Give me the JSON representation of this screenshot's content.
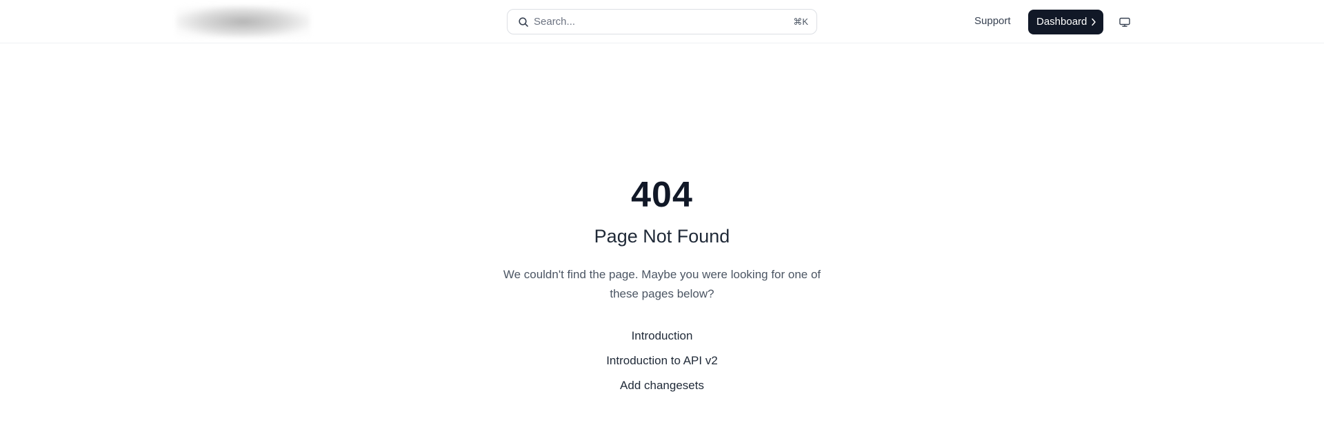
{
  "header": {
    "search": {
      "placeholder": "Search...",
      "shortcut": "⌘K"
    },
    "support_label": "Support",
    "dashboard_label": "Dashboard"
  },
  "main": {
    "code": "404",
    "title": "Page Not Found",
    "description": "We couldn't find the page. Maybe you were looking for one of these pages below?",
    "suggestions": [
      "Introduction",
      "Introduction to API v2",
      "Add changesets"
    ]
  }
}
